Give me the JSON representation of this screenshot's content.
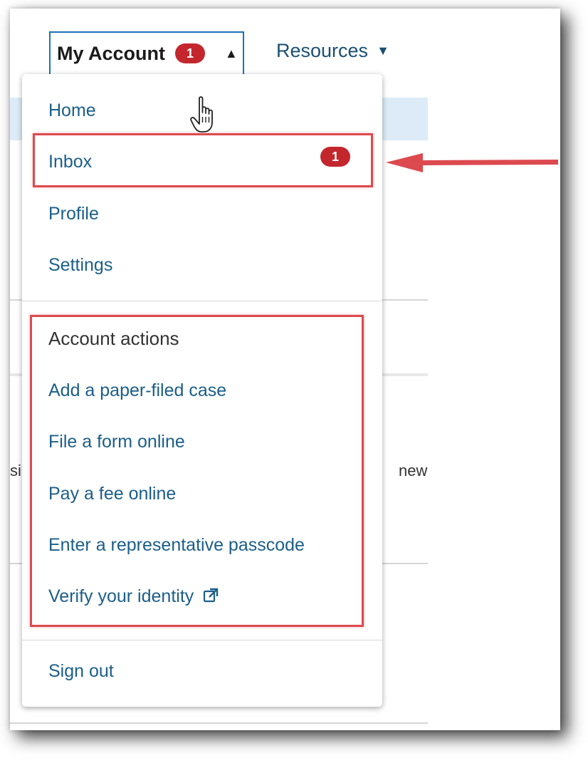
{
  "nav": {
    "my_account_label": "My Account",
    "my_account_badge": "1",
    "resources_label": "Resources",
    "caret_up_icon": "caret-up-icon",
    "caret_down_icon": "caret-down-icon"
  },
  "background": {
    "left_fragment": "si",
    "right_fragment": "new"
  },
  "dropdown": {
    "home": "Home",
    "inbox": "Inbox",
    "inbox_badge": "1",
    "profile": "Profile",
    "settings": "Settings",
    "account_actions_heading": "Account actions",
    "actions": [
      "Add a paper-filed case",
      "File a form online",
      "Pay a fee online",
      "Enter a representative passcode",
      "Verify your identity"
    ],
    "external_link_icon": "external-link-icon",
    "sign_out": "Sign out"
  },
  "colors": {
    "link": "#1b5e8a",
    "badge": "#c3272d",
    "highlight": "#dc4a4f",
    "nav_border": "#1d72b8"
  }
}
